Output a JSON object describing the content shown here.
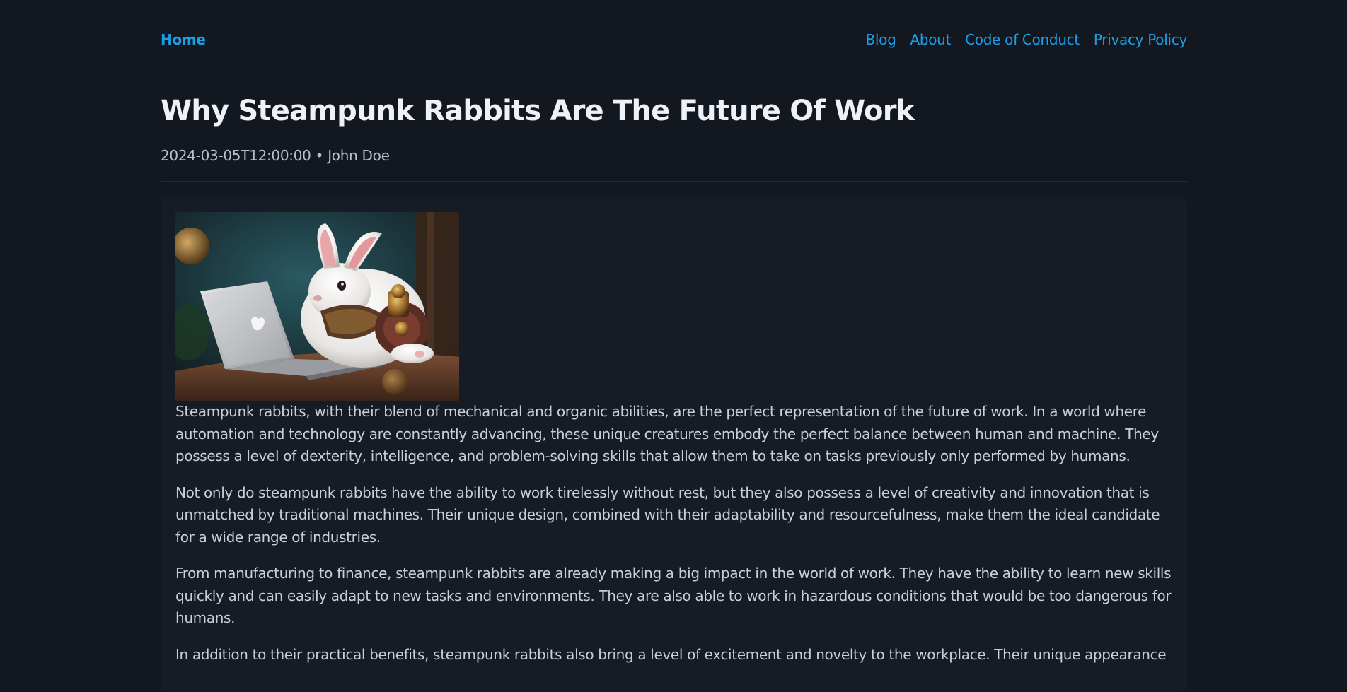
{
  "nav": {
    "home": "Home",
    "links": [
      "Blog",
      "About",
      "Code of Conduct",
      "Privacy Policy"
    ]
  },
  "post": {
    "title": "Why Steampunk Rabbits Are The Future Of Work",
    "date": "2024-03-05T12:00:00",
    "separator": "•",
    "author": "John Doe",
    "image_alt": "A white steampunk rabbit wearing brass armor typing on a laptop",
    "paragraphs": [
      "Steampunk rabbits, with their blend of mechanical and organic abilities, are the perfect representation of the future of work. In a world where automation and technology are constantly advancing, these unique creatures embody the perfect balance between human and machine. They possess a level of dexterity, intelligence, and problem-solving skills that allow them to take on tasks previously only performed by humans.",
      "Not only do steampunk rabbits have the ability to work tirelessly without rest, but they also possess a level of creativity and innovation that is unmatched by traditional machines. Their unique design, combined with their adaptability and resourcefulness, make them the ideal candidate for a wide range of industries.",
      "From manufacturing to finance, steampunk rabbits are already making a big impact in the world of work. They have the ability to learn new skills quickly and can easily adapt to new tasks and environments. They are also able to work in hazardous conditions that would be too dangerous for humans.",
      "In addition to their practical benefits, steampunk rabbits also bring a level of excitement and novelty to the workplace. Their unique appearance"
    ]
  },
  "colors": {
    "background": "#131720",
    "card": "#171b25",
    "link": "#1b9fe6",
    "title": "#eef1f5",
    "text": "#c9ced8"
  }
}
